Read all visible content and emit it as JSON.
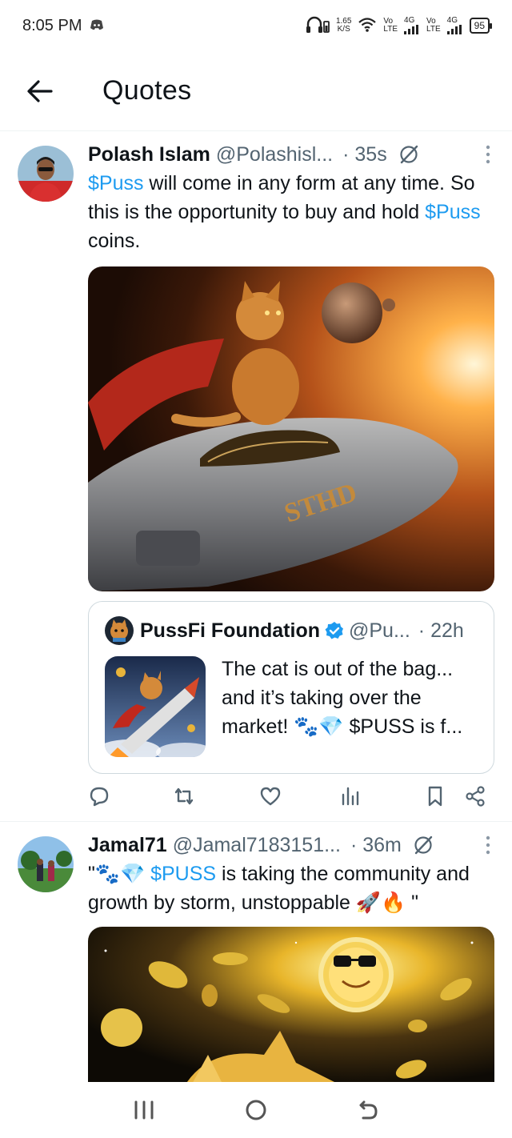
{
  "status_bar": {
    "time": "8:05 PM",
    "speed_value": "1.65",
    "speed_unit": "K/S",
    "sim1_top": "Vo",
    "sim1_bottom": "LTE",
    "sim1_gen": "4G",
    "sim2_top": "Vo",
    "sim2_bottom": "LTE",
    "sim2_gen": "4G",
    "battery": "95",
    "icons": [
      "discord-icon",
      "headphones-icon",
      "wifi-icon",
      "signal-icon",
      "battery-icon"
    ]
  },
  "header": {
    "title": "Quotes",
    "back_icon": "arrow-left-icon"
  },
  "posts": [
    {
      "author": "Polash Islam",
      "handle": "@Polashisl...",
      "time": "· 35s",
      "text_parts": [
        "$Puss",
        " will come in any form at any time. So this is the opportunity to buy and hold ",
        "$Puss",
        " coins."
      ],
      "quote": {
        "author": "PussFi Foundation",
        "handle": "@Pu...",
        "time": "· 22h",
        "text": "The cat is out of the bag... and it’s taking over the market! 🐾💎 $PUSS is f..."
      }
    },
    {
      "author": "Jamal71",
      "handle": "@Jamal7183151...",
      "time": "· 36m",
      "text_parts": [
        "\"🐾💎 ",
        "$PUSS",
        " is taking the community and growth by storm, unstoppable 🚀🔥 \""
      ]
    }
  ],
  "colors": {
    "accent": "#1d9bf0",
    "secondary_text": "#536471",
    "border": "#cfd9de"
  }
}
